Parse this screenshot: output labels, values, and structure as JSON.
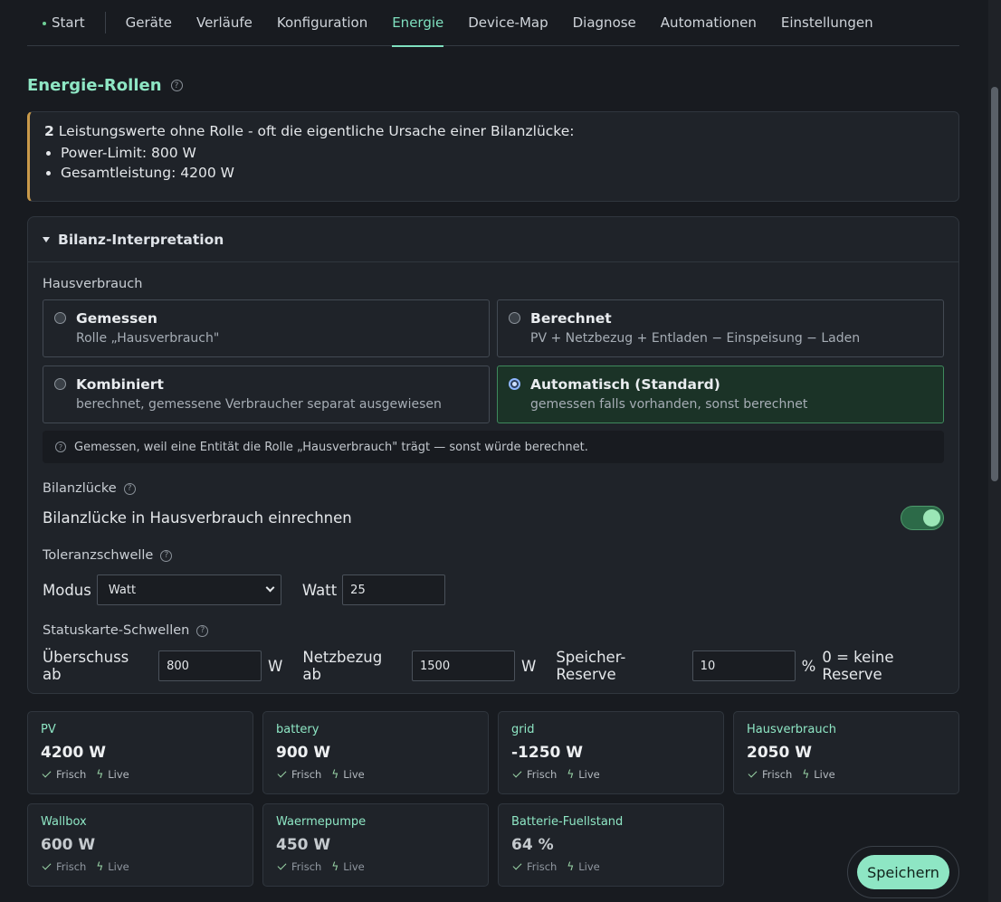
{
  "nav": {
    "items": [
      "Start",
      "Geräte",
      "Verläufe",
      "Konfiguration",
      "Energie",
      "Device-Map",
      "Diagnose",
      "Automationen",
      "Einstellungen"
    ],
    "active": "Energie"
  },
  "title": "Energie-Rollen",
  "warning": {
    "count": "2",
    "text": " Leistungswerte ohne Rolle - oft die eigentliche Ursache einer Bilanzlücke:",
    "items": [
      "Power-Limit: 800 W",
      "Gesamtleistung: 4200 W"
    ]
  },
  "panel": {
    "title": "Bilanz-Interpretation",
    "hausverbrauch_label": "Hausverbrauch",
    "options": [
      {
        "title": "Gemessen",
        "sub": "Rolle „Hausverbrauch\""
      },
      {
        "title": "Berechnet",
        "sub": "PV + Netzbezug + Entladen − Einspeisung − Laden"
      },
      {
        "title": "Kombiniert",
        "sub": "berechnet, gemessene Verbraucher separat ausgewiesen"
      },
      {
        "title": "Automatisch (Standard)",
        "sub": "gemessen falls vorhanden, sonst berechnet"
      }
    ],
    "hint": "Gemessen, weil eine Entität die Rolle „Hausverbrauch\" trägt — sonst würde berechnet.",
    "bilanz_label": "Bilanzlücke",
    "bilanz_toggle_label": "Bilanzlücke in Hausverbrauch einrechnen",
    "tolerance_label": "Toleranzschwelle",
    "mode_label": "Modus",
    "mode_value": "Watt",
    "watt_label": "Watt",
    "watt_value": "25",
    "status_label": "Statuskarte-Schwellen",
    "surplus_label": "Überschuss ab",
    "surplus_value": "800",
    "unit_w": "W",
    "grid_label": "Netzbezug ab",
    "grid_value": "1500",
    "reserve_label": "Speicher-Reserve",
    "reserve_value": "10",
    "unit_pct": "%",
    "reserve_note": "0 = keine Reserve"
  },
  "cards": [
    {
      "name": "PV",
      "value": "4200 W"
    },
    {
      "name": "battery",
      "value": "900 W"
    },
    {
      "name": "grid",
      "value": "-1250 W"
    },
    {
      "name": "Hausverbrauch",
      "value": "2050 W"
    },
    {
      "name": "Wallbox",
      "value": "600 W"
    },
    {
      "name": "Waermepumpe",
      "value": "450 W"
    },
    {
      "name": "Batterie-Fuellstand",
      "value": "64 %"
    }
  ],
  "badges": {
    "fresh": "Frisch",
    "live": "Live"
  },
  "save_label": "Speichern"
}
